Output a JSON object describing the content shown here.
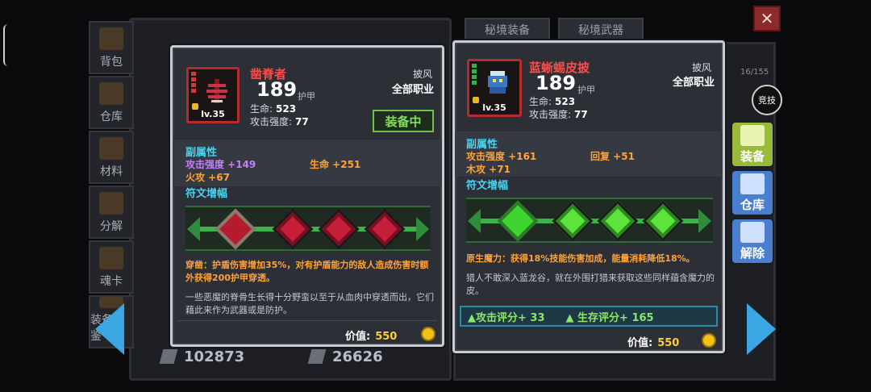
{
  "sidebar": {
    "items": [
      {
        "label": "背包"
      },
      {
        "label": "仓库"
      },
      {
        "label": "材料"
      },
      {
        "label": "分解"
      },
      {
        "label": "魂卡"
      },
      {
        "label": "装备图鉴"
      }
    ]
  },
  "tabs": {
    "secret_gear": "秘境装备",
    "secret_weapon": "秘境武器"
  },
  "background": {
    "counter": "16/155",
    "currency_a": "102873",
    "currency_b": "26626"
  },
  "left_card": {
    "name": "凿脊者",
    "level": "lv.35",
    "armor_value": "189",
    "armor_label": "护甲",
    "hp_label": "生命:",
    "hp_value": "523",
    "atk_label": "攻击强度:",
    "atk_value": "77",
    "slot": "披风",
    "job": "全部职业",
    "equipped_tag": "装备中",
    "sub_attr_title": "副属性",
    "attr_1": "攻击强度 +149",
    "attr_2": "生命 +251",
    "attr_3": "火攻 +67",
    "rune_title": "符文增幅",
    "rune_desc": "穿凿：护盾伤害增加35%，对有护盾能力的敌人造成伤害时额外获得200护甲穿透。",
    "flavor": "一些恶魔的脊骨生长得十分野蛮以至于从血肉中穿透而出，它们藉此来作为武器或是防护。",
    "price_label": "价值:",
    "price_value": "550"
  },
  "right_card": {
    "name": "蓝蜥蜴皮披",
    "level": "lv.35",
    "armor_value": "189",
    "armor_label": "护甲",
    "hp_label": "生命:",
    "hp_value": "523",
    "atk_label": "攻击强度:",
    "atk_value": "77",
    "slot": "披风",
    "job": "全部职业",
    "sub_attr_title": "副属性",
    "attr_1": "攻击强度 +161",
    "attr_2": "回复 +51",
    "attr_3": "木攻 +71",
    "rune_title": "符文增幅",
    "rune_desc": "原生魔力：获得18%技能伤害加成，能量消耗降低18%。",
    "flavor": "猎人不敢深入蓝龙谷，就在外围打猎来获取这些同样蕴含魔力的皮。",
    "score_attack": "▲攻击评分+ 33",
    "score_survive": "▲ 生存评分+ 165",
    "price_label": "价值:",
    "price_value": "550"
  },
  "actions": {
    "compete": "竞技",
    "equip": "装备",
    "store": "仓库",
    "remove": "解除"
  },
  "close_icon": "✕",
  "colors": {
    "rarity_red": "#ff4a4a",
    "section_cyan": "#49d3f0",
    "attr_purple": "#c77dff",
    "attr_orange": "#ffa23a",
    "equip_green": "#7fe05a",
    "nav_blue": "#3aa7e3"
  }
}
